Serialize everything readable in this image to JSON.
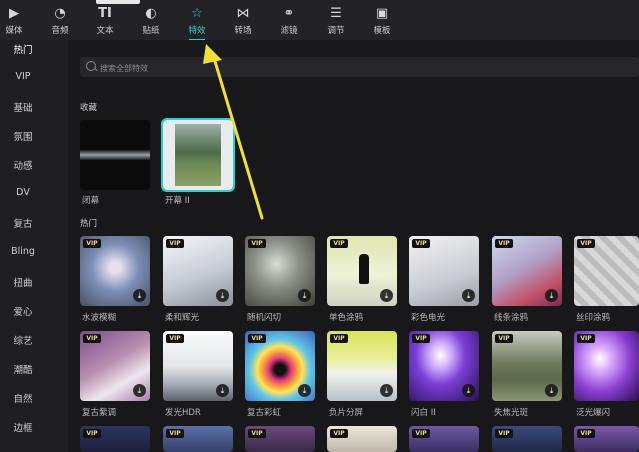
{
  "toolbar": {
    "items": [
      {
        "label": "媒体",
        "icon": "media-icon",
        "glyph": "▶"
      },
      {
        "label": "音频",
        "icon": "audio-icon",
        "glyph": "◔"
      },
      {
        "label": "文本",
        "icon": "text-icon",
        "glyph": "TI"
      },
      {
        "label": "贴纸",
        "icon": "sticker-icon",
        "glyph": "◐"
      },
      {
        "label": "特效",
        "icon": "effects-icon",
        "glyph": "☆"
      },
      {
        "label": "转场",
        "icon": "transition-icon",
        "glyph": "⋈"
      },
      {
        "label": "滤镜",
        "icon": "filter-icon",
        "glyph": "⚭"
      },
      {
        "label": "调节",
        "icon": "adjust-icon",
        "glyph": "☰"
      },
      {
        "label": "模板",
        "icon": "template-icon",
        "glyph": "▣"
      }
    ],
    "active": "特效",
    "accent": "#2ad1cb"
  },
  "sidebar": {
    "items": [
      "热门",
      "VIP",
      "基础",
      "氛围",
      "动感",
      "DV",
      "复古",
      "Bling",
      "扭曲",
      "爱心",
      "综艺",
      "潮酷",
      "自然",
      "边框"
    ]
  },
  "search": {
    "placeholder": "搜索全部特效"
  },
  "favorites": {
    "title": "收藏",
    "items": [
      {
        "label": "闭幕",
        "selected": false
      },
      {
        "label": "开幕 II",
        "selected": true
      }
    ]
  },
  "hot": {
    "title": "热门",
    "vip_badge": "VIP",
    "row1": [
      "水波模糊",
      "柔和辉光",
      "随机闪切",
      "单色涂鸦",
      "彩色电光",
      "线条涂鸦",
      "丝印涂鸦"
    ],
    "row2": [
      "复古紫调",
      "发光HDR",
      "复古彩虹",
      "负片分屏",
      "闪白 II",
      "失焦光斑",
      "泛光爆闪"
    ]
  },
  "annotation": {
    "arrow_color": "#f2df3c"
  }
}
